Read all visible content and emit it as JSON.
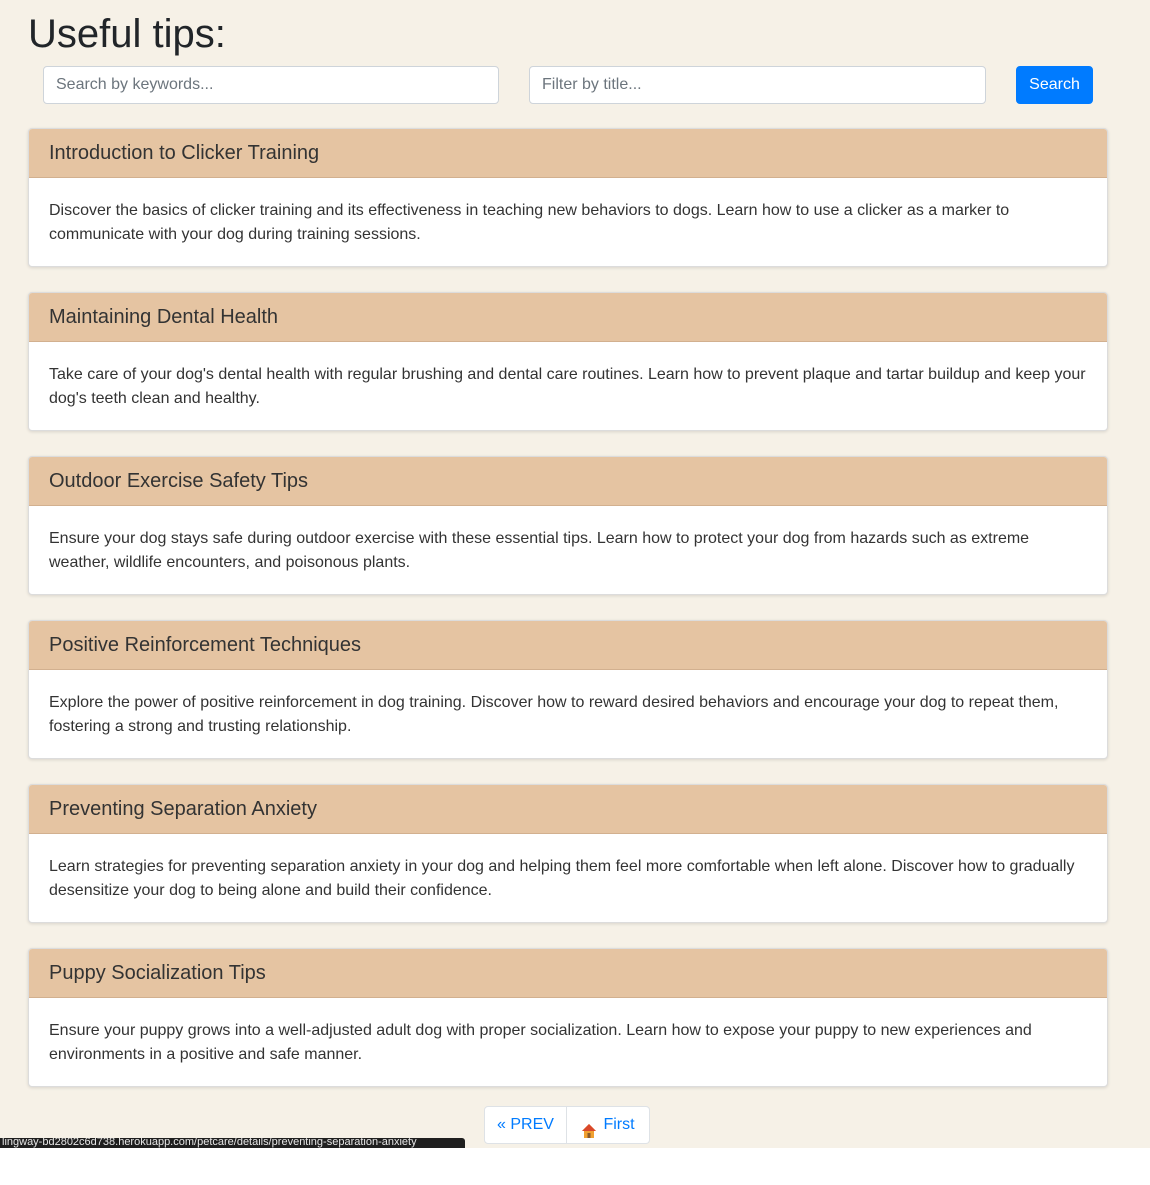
{
  "page": {
    "title": "Useful tips:"
  },
  "search": {
    "keywords_placeholder": "Search by keywords...",
    "keywords_value": "",
    "title_placeholder": "Filter by title...",
    "title_value": "",
    "button_label": "Search"
  },
  "tips": [
    {
      "title": "Introduction to Clicker Training",
      "description": "Discover the basics of clicker training and its effectiveness in teaching new behaviors to dogs. Learn how to use a clicker as a marker to communicate with your dog during training sessions."
    },
    {
      "title": "Maintaining Dental Health",
      "description": "Take care of your dog's dental health with regular brushing and dental care routines. Learn how to prevent plaque and tartar buildup and keep your dog's teeth clean and healthy."
    },
    {
      "title": "Outdoor Exercise Safety Tips",
      "description": "Ensure your dog stays safe during outdoor exercise with these essential tips. Learn how to protect your dog from hazards such as extreme weather, wildlife encounters, and poisonous plants."
    },
    {
      "title": "Positive Reinforcement Techniques",
      "description": "Explore the power of positive reinforcement in dog training. Discover how to reward desired behaviors and encourage your dog to repeat them, fostering a strong and trusting relationship."
    },
    {
      "title": "Preventing Separation Anxiety",
      "description": "Learn strategies for preventing separation anxiety in your dog and helping them feel more comfortable when left alone. Discover how to gradually desensitize your dog to being alone and build their confidence."
    },
    {
      "title": "Puppy Socialization Tips",
      "description": "Ensure your puppy grows into a well-adjusted adult dog with proper socialization. Learn how to expose your puppy to new experiences and environments in a positive and safe manner."
    }
  ],
  "pagination": {
    "prev_label": "« PREV",
    "first_label": "First",
    "first_icon": "house-icon"
  },
  "status_bar": {
    "url": "lingway-bd2802c6d738.herokuapp.com/petcare/details/preventing-separation-anxiety"
  },
  "colors": {
    "page_background": "#f6f1e7",
    "card_header": "#e5c4a2",
    "accent": "#007bff"
  }
}
